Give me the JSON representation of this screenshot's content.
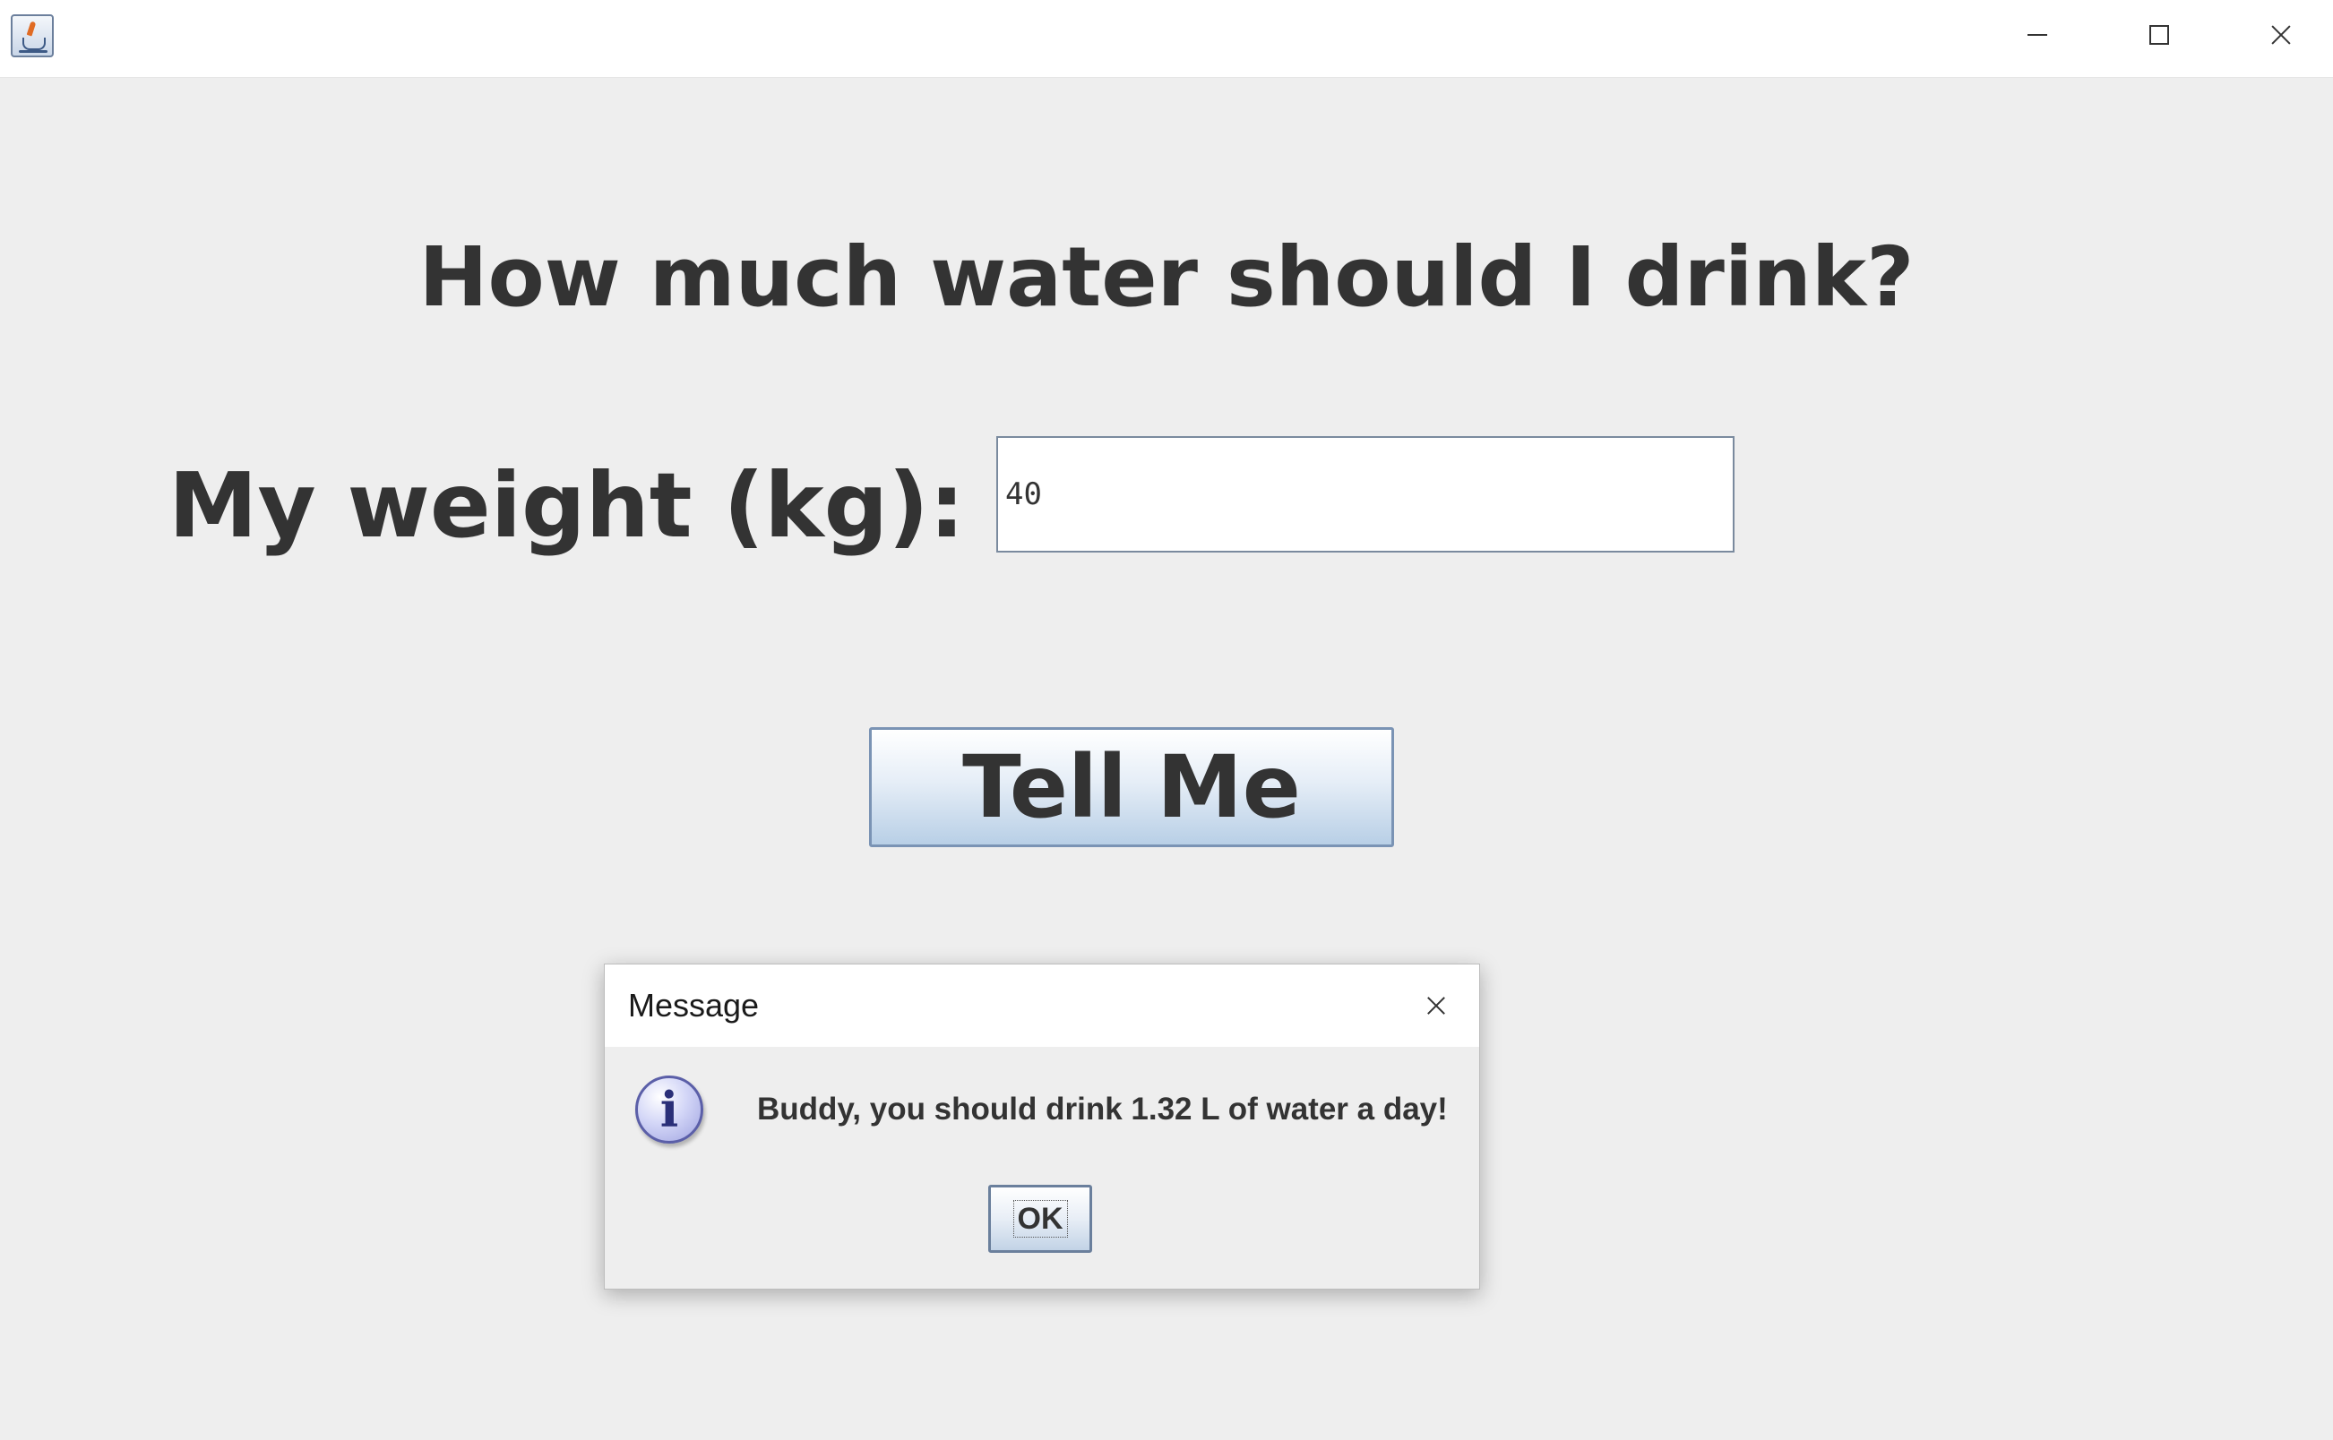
{
  "window": {
    "icon": "java-cup-icon",
    "controls": {
      "minimize": "minimize-icon",
      "maximize": "maximize-icon",
      "close": "close-icon"
    }
  },
  "main": {
    "heading": "How much water should I drink?",
    "weight_label": "My weight (kg):",
    "weight_value": "40",
    "tell_me_label": "Tell Me"
  },
  "dialog": {
    "title": "Message",
    "icon": "info-icon",
    "icon_glyph": "i",
    "message": "Buddy, you should drink 1.32 L of water a day!",
    "ok_label": "OK"
  },
  "colors": {
    "background": "#eeeeee",
    "text": "#333333",
    "button_gradient_bottom": "#b8cfe6",
    "info_icon": "#9fa3e0"
  }
}
